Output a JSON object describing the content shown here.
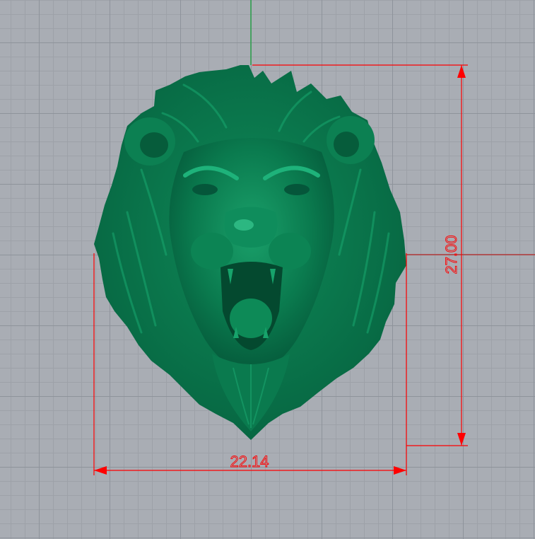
{
  "viewport": {
    "background": "#a9adb4",
    "model_color": "#0a7a4e",
    "dimension_color": "#ff0000",
    "axis_x_color": "#b23a3a",
    "axis_y_color": "#2aa04a"
  },
  "dimensions": {
    "width_value": "22.14",
    "height_value": "27.00"
  },
  "model": {
    "icon": "lion-head-relief-icon"
  }
}
